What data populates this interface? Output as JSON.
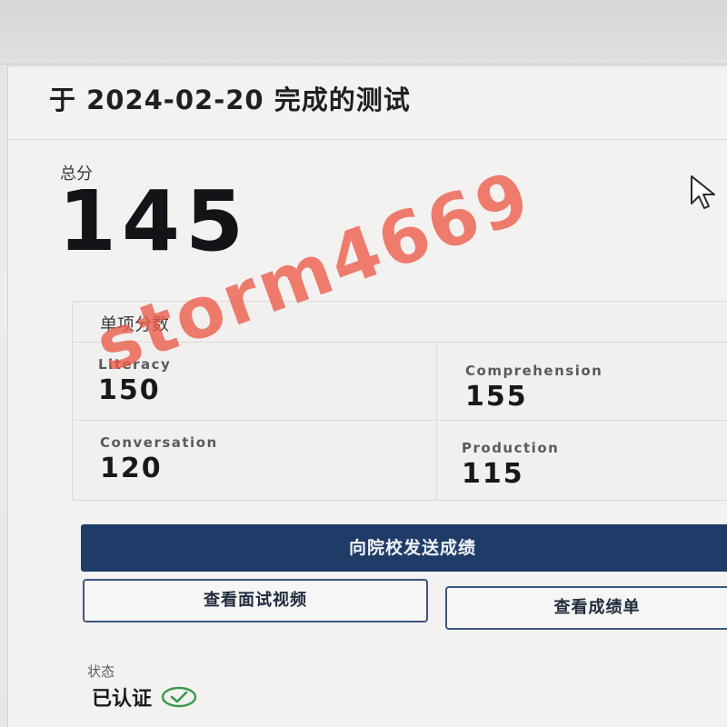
{
  "header": {
    "title": "于 2024-02-20 完成的测试"
  },
  "total": {
    "label": "总分",
    "value": "145"
  },
  "subscores": {
    "title": "单项分数",
    "items": [
      {
        "label": "Literacy",
        "value": "150"
      },
      {
        "label": "Comprehension",
        "value": "155"
      },
      {
        "label": "Conversation",
        "value": "120"
      },
      {
        "label": "Production",
        "value": "115"
      }
    ]
  },
  "actions": {
    "send_label": "向院校发送成绩",
    "view_video_label": "查看面试视频",
    "view_transcript_label": "查看成绩单"
  },
  "status": {
    "label": "状态",
    "value": "已认证",
    "icon": "check-circle-icon",
    "icon_color": "#3a9a4a"
  },
  "watermark": {
    "text": "storm4669",
    "color": "#ec5a46"
  },
  "colors": {
    "primary_button": "#1f3c69",
    "outline_border": "#3b5880"
  }
}
